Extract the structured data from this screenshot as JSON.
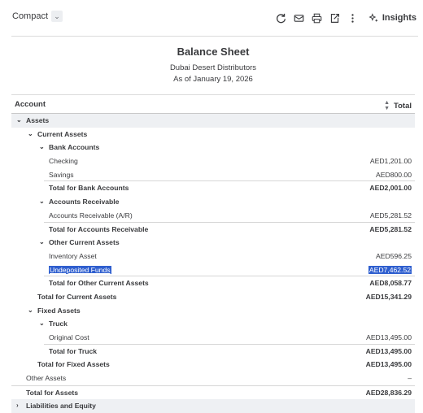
{
  "toolbar": {
    "view_label": "Compact",
    "insights_label": "Insights"
  },
  "report": {
    "title": "Balance Sheet",
    "company": "Dubai Desert Distributors",
    "date": "As of January 19, 2026"
  },
  "columns": {
    "account": "Account",
    "total": "Total"
  },
  "rows": [
    {
      "label": "Assets",
      "amount": ""
    },
    {
      "label": "Current Assets",
      "amount": ""
    },
    {
      "label": "Bank Accounts",
      "amount": ""
    },
    {
      "label": "Checking",
      "amount": "AED1,201.00"
    },
    {
      "label": "Savings",
      "amount": "AED800.00"
    },
    {
      "label": "Total for Bank Accounts",
      "amount": "AED2,001.00"
    },
    {
      "label": "Accounts Receivable",
      "amount": ""
    },
    {
      "label": "Accounts Receivable (A/R)",
      "amount": "AED5,281.52"
    },
    {
      "label": "Total for Accounts Receivable",
      "amount": "AED5,281.52"
    },
    {
      "label": "Other Current Assets",
      "amount": ""
    },
    {
      "label": "Inventory Asset",
      "amount": "AED596.25"
    },
    {
      "label": "Undeposited Funds",
      "amount": "AED7,462.52"
    },
    {
      "label": "Total for Other Current Assets",
      "amount": "AED8,058.77"
    },
    {
      "label": "Total for Current Assets",
      "amount": "AED15,341.29"
    },
    {
      "label": "Fixed Assets",
      "amount": ""
    },
    {
      "label": "Truck",
      "amount": ""
    },
    {
      "label": "Original Cost",
      "amount": "AED13,495.00"
    },
    {
      "label": "Total for Truck",
      "amount": "AED13,495.00"
    },
    {
      "label": "Total for Fixed Assets",
      "amount": "AED13,495.00"
    },
    {
      "label": "Other Assets",
      "amount": "–"
    },
    {
      "label": "Total for Assets",
      "amount": "AED28,836.29"
    },
    {
      "label": "Liabilities and Equity",
      "amount": ""
    }
  ],
  "icons": [
    "refresh-icon",
    "email-icon",
    "print-icon",
    "export-icon",
    "more-icon",
    "insights-icon"
  ]
}
